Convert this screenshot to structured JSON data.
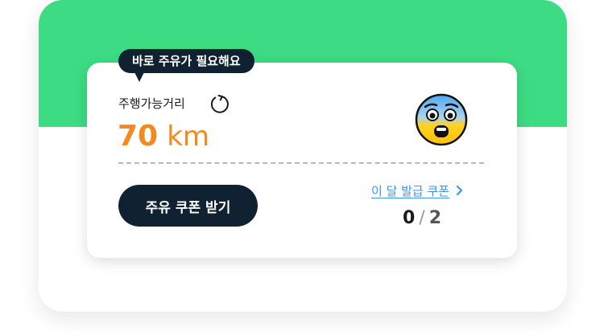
{
  "tooltip": {
    "text": "바로 주유가 필요해요"
  },
  "range": {
    "label": "주행가능거리",
    "value": "70",
    "unit": "km"
  },
  "action": {
    "button_label": "주유 쿠폰 받기"
  },
  "coupons": {
    "link_label": "이 달 발급 쿠폰",
    "used": "0",
    "separator": "/",
    "total": "2"
  },
  "icons": {
    "refresh": "refresh-icon",
    "emoji": "fearful-face-emoji-icon",
    "chevron": "chevron-right-icon"
  },
  "colors": {
    "green": "#3ddc84",
    "navy": "#102231",
    "orange": "#f48a1e",
    "link": "#3b95e8"
  }
}
